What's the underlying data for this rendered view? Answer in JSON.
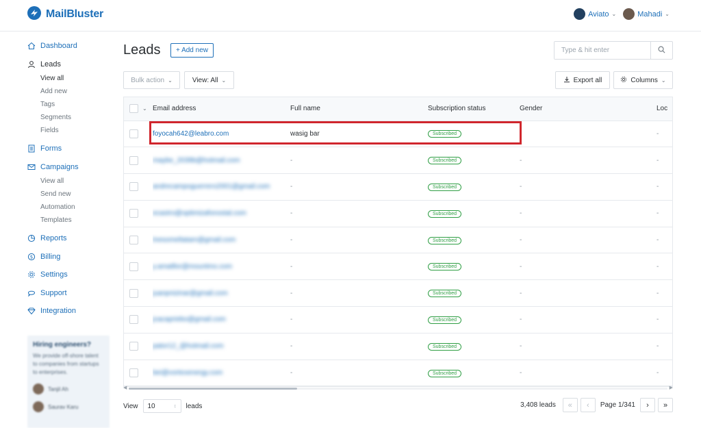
{
  "brand": {
    "name": "MailBluster"
  },
  "topnav": {
    "org": "Aviato",
    "user": "Mahadi"
  },
  "sidebar": {
    "items": [
      {
        "label": "Dashboard"
      },
      {
        "label": "Leads",
        "sub": [
          "View all",
          "Add new",
          "Tags",
          "Segments",
          "Fields"
        ]
      },
      {
        "label": "Forms"
      },
      {
        "label": "Campaigns",
        "sub": [
          "View all",
          "Send new",
          "Automation",
          "Templates"
        ]
      },
      {
        "label": "Reports"
      },
      {
        "label": "Billing"
      },
      {
        "label": "Settings"
      },
      {
        "label": "Support"
      },
      {
        "label": "Integration"
      }
    ],
    "promo": {
      "title": "Hiring engineers?",
      "desc": "We provide off-shore talent to companies from startups to enterprises.",
      "person1": "Tanjil Ah",
      "person2": "Saurav Karu"
    }
  },
  "page": {
    "title": "Leads",
    "add_label": "+ Add new"
  },
  "search": {
    "placeholder": "Type & hit enter"
  },
  "toolbar": {
    "bulk_label": "Bulk action",
    "view_label": "View: All",
    "export_label": "Export all",
    "columns_label": "Columns"
  },
  "table": {
    "headers": {
      "email": "Email address",
      "name": "Full name",
      "status": "Subscription status",
      "gender": "Gender",
      "location": "Loc"
    },
    "rows": [
      {
        "email": "foyocah642@leabro.com",
        "name": "wasig bar",
        "status": "Subscribed",
        "gender": "-",
        "location": "-"
      },
      {
        "email": "maybe_2039b@hotmail.com",
        "name": "-",
        "status": "Subscribed",
        "gender": "-",
        "location": "-"
      },
      {
        "email": "andrecampoguerrero2001@gmail.com",
        "name": "-",
        "status": "Subscribed",
        "gender": "-",
        "location": "-"
      },
      {
        "email": "ecastro@optimizafonostal.com",
        "name": "-",
        "status": "Subscribed",
        "gender": "-",
        "location": "-"
      },
      {
        "email": "tnesomeltatam@gmail.com",
        "name": "-",
        "status": "Subscribed",
        "gender": "-",
        "location": "-"
      },
      {
        "email": "y.amatllor@mountmo.com",
        "name": "-",
        "status": "Subscribed",
        "gender": "-",
        "location": "-"
      },
      {
        "email": "juanpnizinar@gmail.com",
        "name": "-",
        "status": "Subscribed",
        "gender": "-",
        "location": "-"
      },
      {
        "email": "jcacapriebo@gmail.com",
        "name": "-",
        "status": "Subscribed",
        "gender": "-",
        "location": "-"
      },
      {
        "email": "pator12_@hotmail.com",
        "name": "-",
        "status": "Subscribed",
        "gender": "-",
        "location": "-"
      },
      {
        "email": "bei@vortexenergy.com",
        "name": "-",
        "status": "Subscribed",
        "gender": "-",
        "location": "-"
      }
    ]
  },
  "footer": {
    "view_label": "View",
    "page_size": "10",
    "leads_label": "leads",
    "total": "3,408 leads",
    "page_info": "Page 1/341"
  },
  "colors": {
    "primary": "#1d6fb8",
    "success": "#2f9e44",
    "highlight": "#d0262d"
  }
}
